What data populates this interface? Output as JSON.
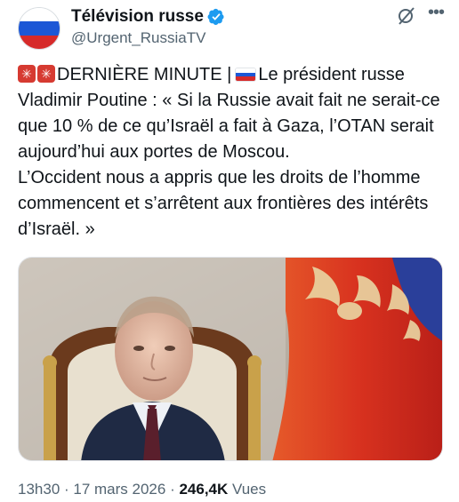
{
  "account": {
    "display_name": "Télévision russe",
    "handle": "@Urgent_RussiaTV",
    "verified_icon": "verified-badge-icon",
    "avatar": "russian-flag-avatar"
  },
  "header_icons": {
    "grok": "grok-icon",
    "more": "more-options-icon"
  },
  "post": {
    "breaking_label": "DERNIÈRE MINUTE |",
    "text_part1": "Le président russe Vladimir Poutine : « Si la Russie avait fait ne serait-ce que 10 % de ce qu’Israël a fait à Gaza, l’OTAN serait aujourd’hui aux portes de Moscou.",
    "text_part2": "L’Occident nous a appris que les droits de l’homme commencent et s’arrêtent aux frontières des intérêts d’Israël. »",
    "emojis": [
      "siren-emoji",
      "siren-emoji",
      "russia-flag-emoji"
    ]
  },
  "media": {
    "image": "photo-of-man-seated-before-russian-flag"
  },
  "meta": {
    "time": "13h30",
    "separator1": " · ",
    "date": "17 mars 2026",
    "separator2": " · ",
    "views_count": "246,4K",
    "views_label": " Vues"
  },
  "colors": {
    "text": "#0f1419",
    "secondary_text": "#536471",
    "verified_blue": "#1d9bf0",
    "siren_red": "#d63a31",
    "flag_white": "#ffffff",
    "flag_blue": "#1c57d6",
    "flag_red": "#d62a2a"
  }
}
